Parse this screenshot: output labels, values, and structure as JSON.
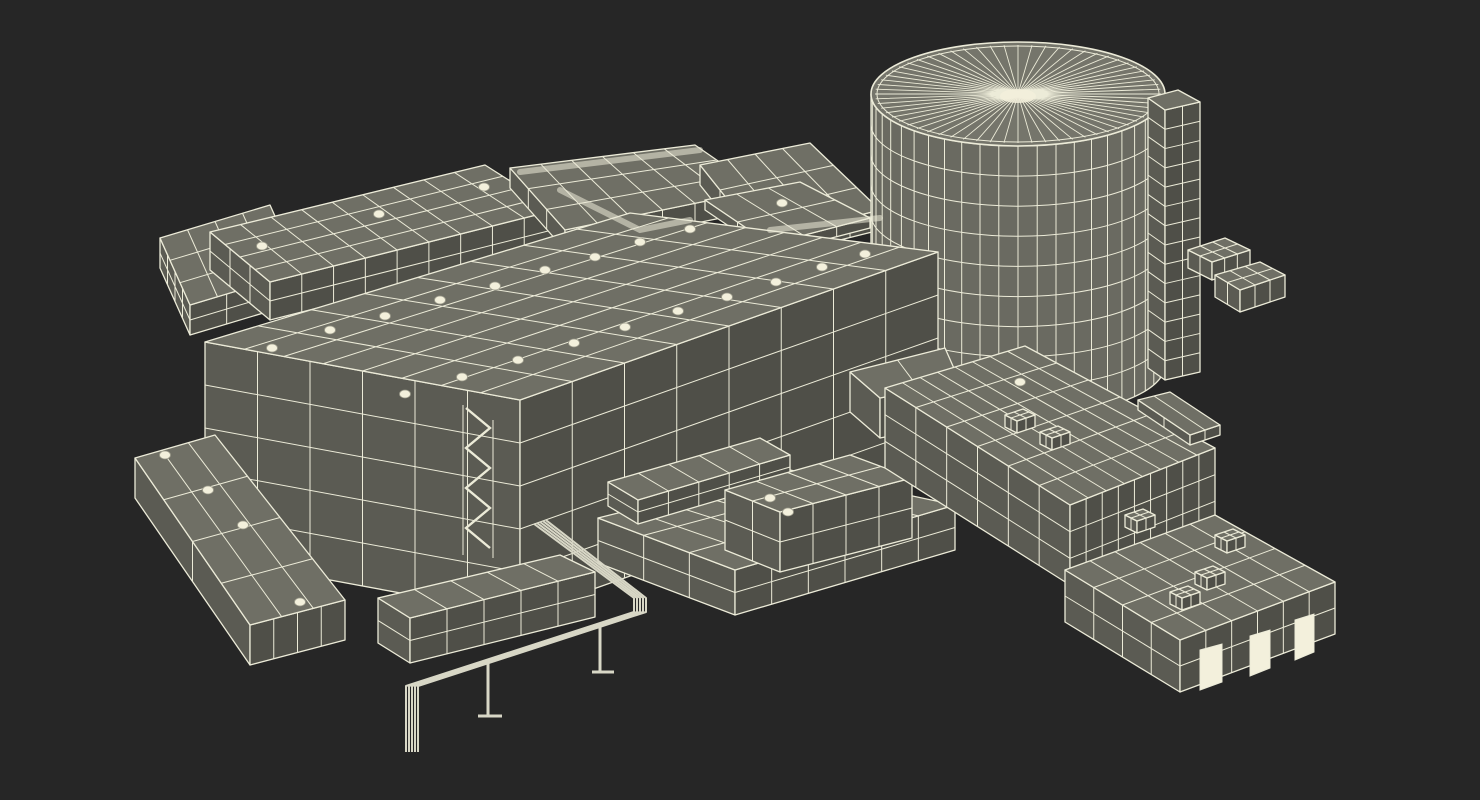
{
  "scene": {
    "background_color": "#262626",
    "wire_color": "#ecebd8",
    "roof_color": "#6f6f65",
    "wall_left_color": "#5b5b53",
    "wall_right_color": "#4f4f48",
    "tank_wall_color": "#6a6a61",
    "tank_top_color": "#75756b",
    "pipe_color": "#d8d7c6",
    "door_color": "#f3f0dc"
  }
}
